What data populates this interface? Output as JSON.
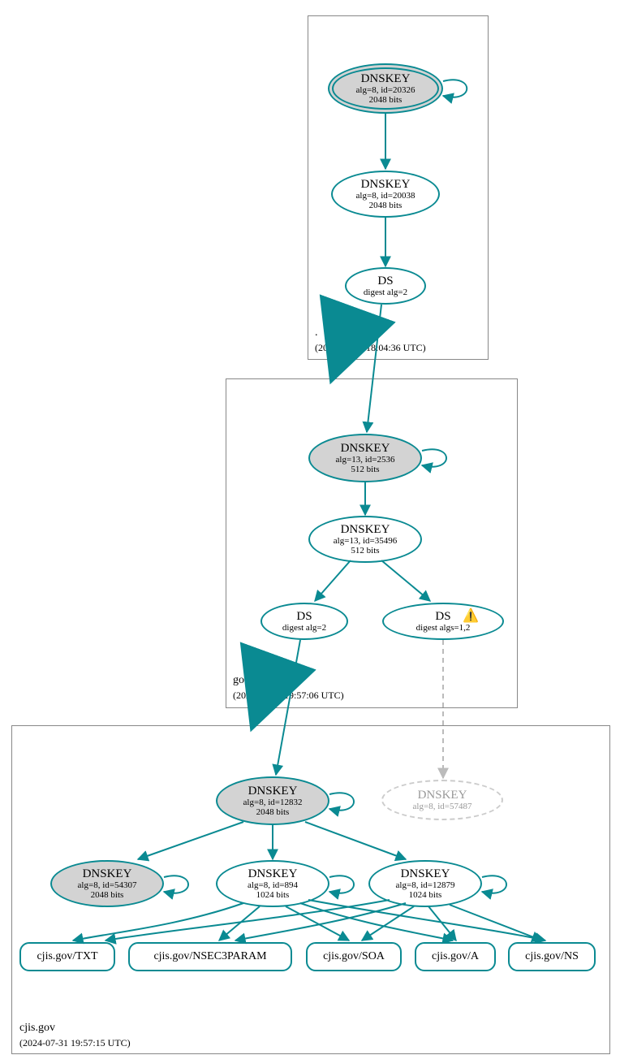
{
  "zones": {
    "root": {
      "name": ".",
      "timestamp": "(2024-07-31 18:04:36 UTC)"
    },
    "gov": {
      "name": "gov",
      "timestamp": "(2024-07-31 19:57:06 UTC)"
    },
    "cjis": {
      "name": "cjis.gov",
      "timestamp": "(2024-07-31 19:57:15 UTC)"
    }
  },
  "nodes": {
    "root_ksk": {
      "title": "DNSKEY",
      "line1": "alg=8, id=20326",
      "line2": "2048 bits"
    },
    "root_zsk": {
      "title": "DNSKEY",
      "line1": "alg=8, id=20038",
      "line2": "2048 bits"
    },
    "root_ds": {
      "title": "DS",
      "line1": "digest alg=2"
    },
    "gov_ksk": {
      "title": "DNSKEY",
      "line1": "alg=13, id=2536",
      "line2": "512 bits"
    },
    "gov_zsk": {
      "title": "DNSKEY",
      "line1": "alg=13, id=35496",
      "line2": "512 bits"
    },
    "gov_ds1": {
      "title": "DS",
      "line1": "digest alg=2"
    },
    "gov_ds2": {
      "title": "DS",
      "line1": "digest algs=1,2"
    },
    "cjis_ksk": {
      "title": "DNSKEY",
      "line1": "alg=8, id=12832",
      "line2": "2048 bits"
    },
    "cjis_ghost": {
      "title": "DNSKEY",
      "line1": "alg=8, id=57487"
    },
    "cjis_k2": {
      "title": "DNSKEY",
      "line1": "alg=8, id=54307",
      "line2": "2048 bits"
    },
    "cjis_k3": {
      "title": "DNSKEY",
      "line1": "alg=8, id=894",
      "line2": "1024 bits"
    },
    "cjis_k4": {
      "title": "DNSKEY",
      "line1": "alg=8, id=12879",
      "line2": "1024 bits"
    }
  },
  "rrsets": {
    "txt": "cjis.gov/TXT",
    "nsec3": "cjis.gov/NSEC3PARAM",
    "soa": "cjis.gov/SOA",
    "a": "cjis.gov/A",
    "ns": "cjis.gov/NS"
  }
}
